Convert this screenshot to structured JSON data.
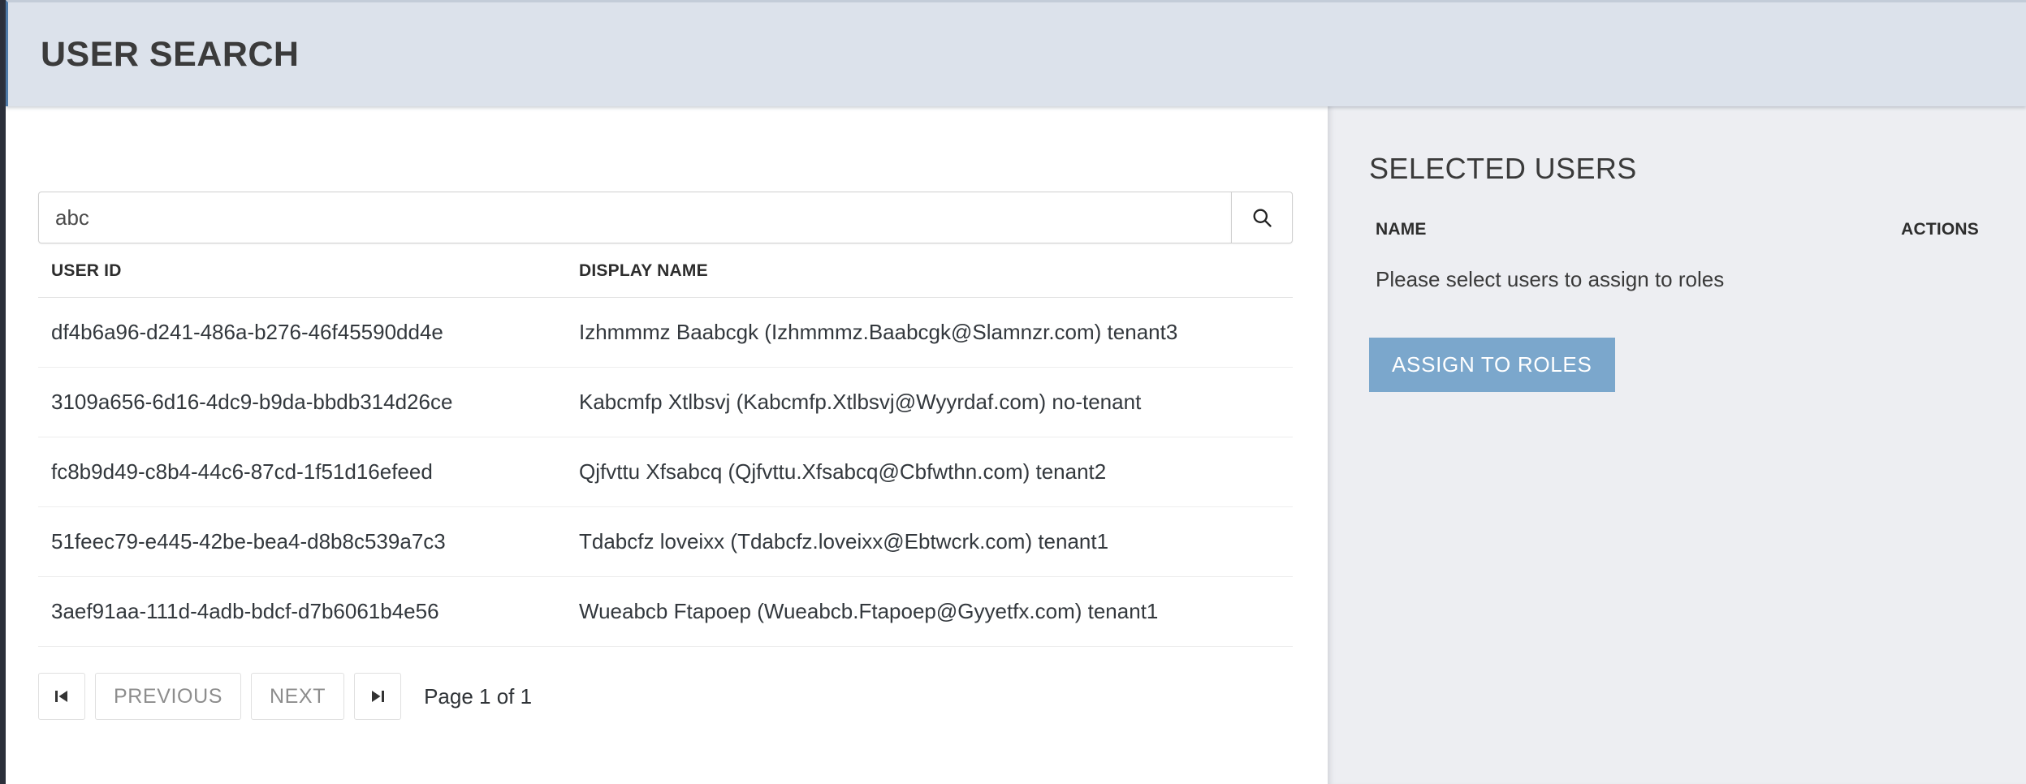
{
  "header": {
    "title": "USER SEARCH"
  },
  "search": {
    "value": "abc",
    "placeholder": "",
    "button_icon": "search-icon"
  },
  "results": {
    "columns": [
      "USER ID",
      "DISPLAY NAME"
    ],
    "rows": [
      {
        "user_id": "df4b6a96-d241-486a-b276-46f45590dd4e",
        "display_name": "Izhmmmz Baabcgk (Izhmmmz.Baabcgk@Slamnzr.com) tenant3"
      },
      {
        "user_id": "3109a656-6d16-4dc9-b9da-bbdb314d26ce",
        "display_name": "Kabcmfp Xtlbsvj (Kabcmfp.Xtlbsvj@Wyyrdaf.com) no-tenant"
      },
      {
        "user_id": "fc8b9d49-c8b4-44c6-87cd-1f51d16efeed",
        "display_name": "Qjfvttu Xfsabcq (Qjfvttu.Xfsabcq@Cbfwthn.com) tenant2"
      },
      {
        "user_id": "51feec79-e445-42be-bea4-d8b8c539a7c3",
        "display_name": "Tdabcfz loveixx (Tdabcfz.loveixx@Ebtwcrk.com) tenant1"
      },
      {
        "user_id": "3aef91aa-111d-4adb-bdcf-d7b6061b4e56",
        "display_name": "Wueabcb Ftapoep (Wueabcb.Ftapoep@Gyyetfx.com) tenant1"
      }
    ]
  },
  "pagination": {
    "first_icon": "skip-to-first-icon",
    "previous_label": "PREVIOUS",
    "next_label": "NEXT",
    "last_icon": "skip-to-last-icon",
    "status": "Page 1 of 1"
  },
  "selected_users": {
    "title": "SELECTED USERS",
    "columns": [
      "NAME",
      "ACTIONS"
    ],
    "empty_message": "Please select users to assign to roles",
    "assign_label": "ASSIGN TO ROLES",
    "assign_color": "#7ba7cc"
  }
}
